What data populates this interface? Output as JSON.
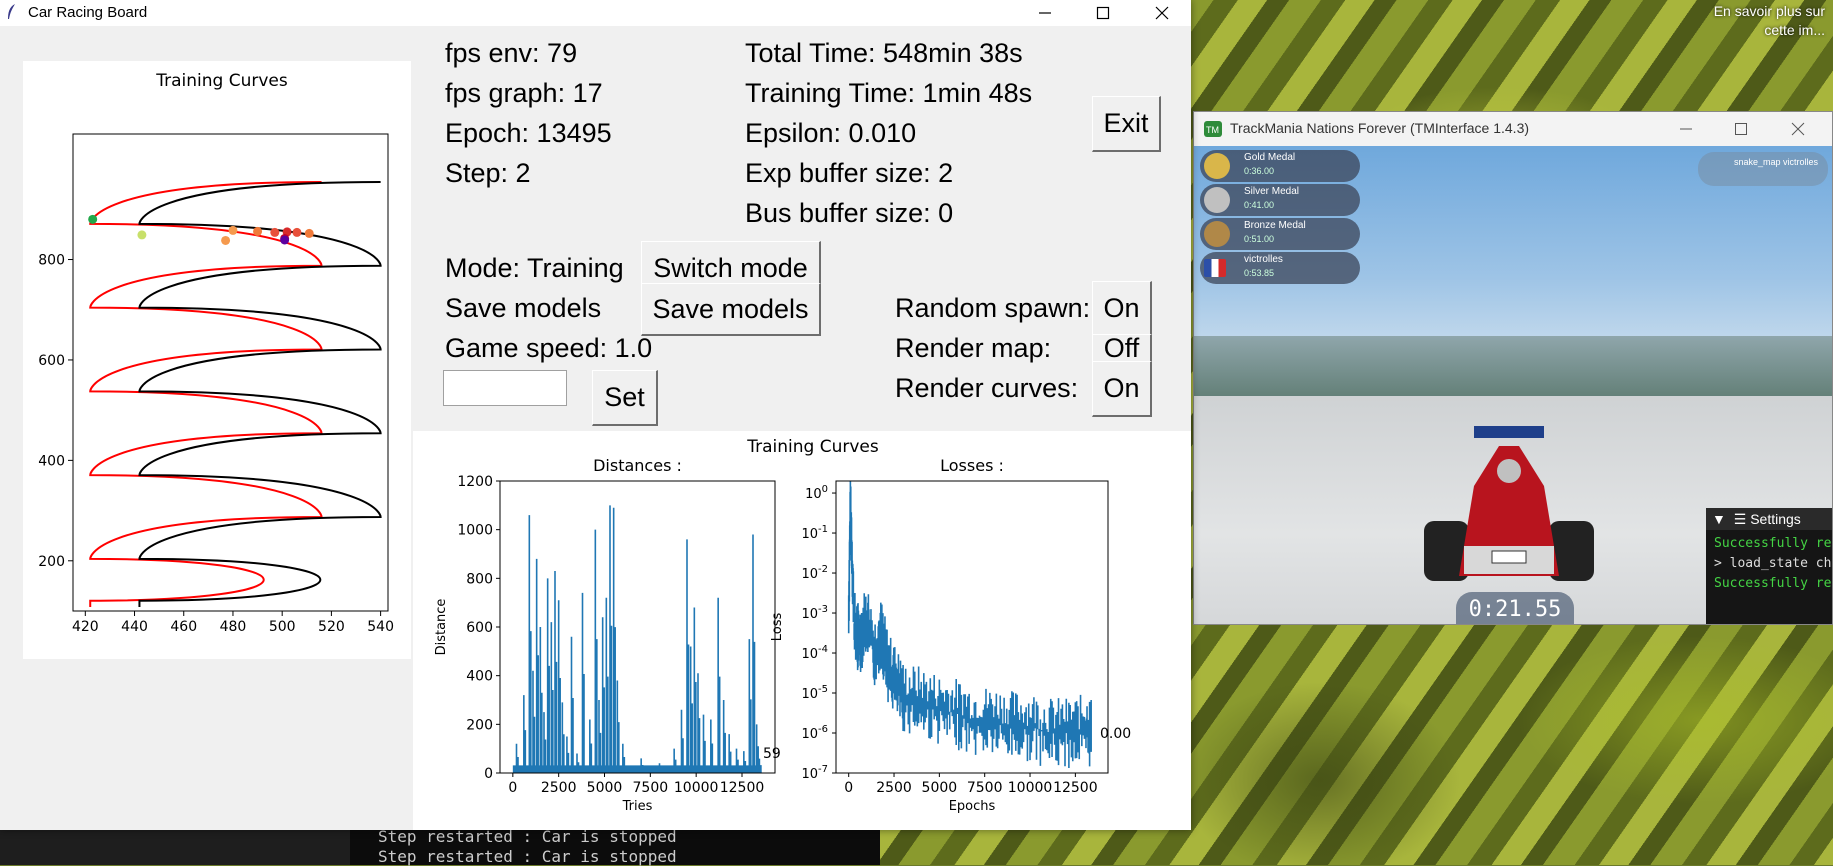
{
  "desktop": {
    "caption": "En savoir plus sur cette im...",
    "terminal_lines": [
      "Step restarted : Car is stopped",
      "Step restarted : Car is stopped"
    ]
  },
  "window": {
    "title": "Car Racing Board",
    "minimize_label": "—",
    "maximize_label": "☐",
    "close_label": "✕"
  },
  "stats": {
    "fps_env": "fps env: 79",
    "fps_graph": "fps graph: 17",
    "epoch": "Epoch: 13495",
    "step": "Step: 2",
    "total_time": "Total Time: 548min 38s",
    "training_time": "Training Time: 1min 48s",
    "epsilon": "Epsilon: 0.010",
    "exp_buffer": "Exp buffer size: 2",
    "bus_buffer": "Bus buffer size: 0"
  },
  "controls": {
    "exit": "Exit",
    "mode_label": "Mode: Training",
    "switch_mode": "Switch mode",
    "save_label": "Save models",
    "save_button": "Save models",
    "game_speed_label": "Game speed: 1.0",
    "game_speed_input": "",
    "set_button": "Set",
    "random_spawn_label": "Random spawn:",
    "random_spawn_value": "On",
    "render_map_label": "Render map:",
    "render_map_value": "Off",
    "render_curves_label": "Render curves:",
    "render_curves_value": "On"
  },
  "chart_data": [
    {
      "type": "line",
      "title": "Training Curves",
      "xlim": [
        415,
        543
      ],
      "ylim": [
        100,
        1050
      ],
      "xticks": [
        420,
        440,
        460,
        480,
        500,
        520,
        540
      ],
      "yticks": [
        200,
        400,
        600,
        800
      ],
      "series": [
        {
          "color": "#ff0000",
          "x_min": 422,
          "x_max": 516,
          "y_start": 108,
          "y_end": 942,
          "loops": 5
        },
        {
          "color": "#000000",
          "x_min": 442,
          "x_max": 540,
          "y_start": 108,
          "y_end": 942,
          "loops": 5
        }
      ],
      "points": [
        {
          "x": 423,
          "y": 880,
          "color": "#22a84a"
        },
        {
          "x": 443,
          "y": 849,
          "color": "#c8e06a"
        },
        {
          "x": 477,
          "y": 838,
          "color": "#f59a4e"
        },
        {
          "x": 480,
          "y": 858,
          "color": "#f59a4e"
        },
        {
          "x": 490,
          "y": 856,
          "color": "#f07a3a"
        },
        {
          "x": 497,
          "y": 854,
          "color": "#e8503a"
        },
        {
          "x": 502,
          "y": 855,
          "color": "#d82a2a"
        },
        {
          "x": 506,
          "y": 854,
          "color": "#e8503a"
        },
        {
          "x": 511,
          "y": 852,
          "color": "#f07a3a"
        },
        {
          "x": 501,
          "y": 842,
          "color": "#c0002a"
        },
        {
          "x": 501,
          "y": 839,
          "color": "#5a00a0"
        }
      ]
    },
    {
      "type": "line",
      "title": "Training Curves",
      "subplots": [
        {
          "title": "Distances :",
          "xlabel": "Tries",
          "ylabel": "Distance",
          "xlim": [
            -700,
            14300
          ],
          "ylim": [
            0,
            1200
          ],
          "xticks": [
            0,
            2500,
            5000,
            7500,
            10000,
            12500
          ],
          "yticks": [
            0,
            200,
            400,
            600,
            800,
            1000,
            1200
          ],
          "annotation": "59",
          "color": "#1f77b4",
          "peaks": [
            [
              200,
              120
            ],
            [
              600,
              320
            ],
            [
              900,
              1060
            ],
            [
              1100,
              420
            ],
            [
              1300,
              880
            ],
            [
              1500,
              600
            ],
            [
              1700,
              250
            ],
            [
              1900,
              800
            ],
            [
              2100,
              620
            ],
            [
              2300,
              830
            ],
            [
              2500,
              710
            ],
            [
              2700,
              290
            ],
            [
              2950,
              150
            ],
            [
              3200,
              560
            ],
            [
              3500,
              80
            ],
            [
              3800,
              740
            ],
            [
              4200,
              220
            ],
            [
              4500,
              1000
            ],
            [
              4700,
              300
            ],
            [
              4900,
              640
            ],
            [
              5100,
              720
            ],
            [
              5300,
              1100
            ],
            [
              5500,
              1090
            ],
            [
              5700,
              380
            ],
            [
              6000,
              120
            ],
            [
              6300,
              30
            ],
            [
              7000,
              60
            ],
            [
              8000,
              40
            ],
            [
              8800,
              100
            ],
            [
              9200,
              260
            ],
            [
              9500,
              960
            ],
            [
              9700,
              520
            ],
            [
              9900,
              680
            ],
            [
              10100,
              410
            ],
            [
              10400,
              240
            ],
            [
              10800,
              220
            ],
            [
              11200,
              720
            ],
            [
              11500,
              300
            ],
            [
              11800,
              160
            ],
            [
              12200,
              100
            ],
            [
              12600,
              90
            ],
            [
              12900,
              550
            ],
            [
              13100,
              980
            ],
            [
              13300,
              200
            ],
            [
              13450,
              59
            ]
          ]
        },
        {
          "title": "Losses :",
          "xlabel": "Epochs",
          "ylabel": "Loss",
          "yscale": "log",
          "xlim": [
            -700,
            14300
          ],
          "ylim": [
            1e-07,
            2
          ],
          "xticks": [
            0,
            2500,
            5000,
            7500,
            10000,
            12500
          ],
          "ytick_labels": [
            "10^-7",
            "10^-6",
            "10^-5",
            "10^-4",
            "10^-3",
            "10^-2",
            "10^-1",
            "10^0"
          ],
          "annotation": "0.00",
          "color": "#1f77b4",
          "envelope": [
            [
              0,
              0.001
            ],
            [
              100,
              0.6
            ],
            [
              300,
              0.0005
            ],
            [
              600,
              0.0002
            ],
            [
              1000,
              0.0008
            ],
            [
              1400,
              0.0001
            ],
            [
              1800,
              0.0003
            ],
            [
              2200,
              4e-05
            ],
            [
              2600,
              2e-05
            ],
            [
              3000,
              8e-06
            ],
            [
              4000,
              6e-06
            ],
            [
              5000,
              4e-06
            ],
            [
              6000,
              3e-06
            ],
            [
              7000,
              2e-06
            ],
            [
              8000,
              2e-06
            ],
            [
              9000,
              1.5e-06
            ],
            [
              10000,
              1.5e-06
            ],
            [
              11000,
              1e-06
            ],
            [
              12000,
              1e-06
            ],
            [
              13000,
              1.2e-06
            ],
            [
              13400,
              1e-06
            ]
          ]
        }
      ]
    }
  ],
  "trackmania": {
    "title": "TrackMania Nations Forever (TMInterface 1.4.3)",
    "medals": [
      {
        "name": "Gold Medal",
        "time": "0:36.00",
        "color": "#d9b64a"
      },
      {
        "name": "Silver Medal",
        "time": "0:41.00",
        "color": "#c0c0c0"
      },
      {
        "name": "Bronze Medal",
        "time": "0:51.00",
        "color": "#b08848"
      },
      {
        "name": "victrolles",
        "time": "0:53.85",
        "color": "#2c4fa8"
      }
    ],
    "map_info": "snake_map victrolles",
    "timer": "0:21.55",
    "settings_title": "Settings",
    "console_lines": [
      "Successfully re",
      "> load_state ch",
      "Successfully re"
    ]
  }
}
